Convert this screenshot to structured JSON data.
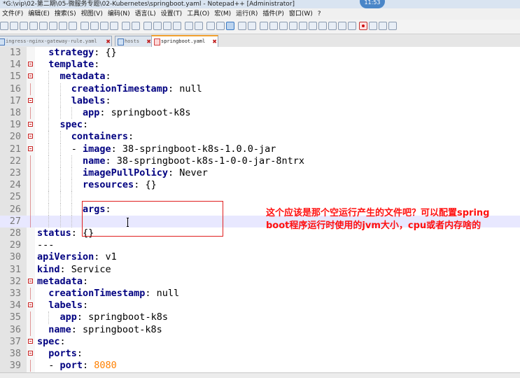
{
  "window": {
    "title": "*G:\\vip\\02-第二期\\05-微服务专题\\02-Kubernetes\\springboot.yaml - Notepad++ [Administrator]",
    "clock": "11:53"
  },
  "menu": [
    "文件(F)",
    "编辑(E)",
    "搜索(S)",
    "视图(V)",
    "编码(N)",
    "语言(L)",
    "设置(T)",
    "工具(O)",
    "宏(M)",
    "运行(R)",
    "插件(P)",
    "窗口(W)",
    "?"
  ],
  "tabs": [
    {
      "label": "ingress-nginx-gateway-rule.yaml",
      "active": false
    },
    {
      "label": "hosts",
      "active": false
    },
    {
      "label": "springboot.yaml",
      "active": true
    }
  ],
  "editor": {
    "current_line": 27,
    "lines": [
      {
        "n": "13",
        "indent": 2,
        "key": "strategy",
        "rest": ": {}"
      },
      {
        "n": "14",
        "indent": 2,
        "key": "template",
        "rest": ":"
      },
      {
        "n": "15",
        "indent": 4,
        "key": "metadata",
        "rest": ":"
      },
      {
        "n": "16",
        "indent": 6,
        "key": "creationTimestamp",
        "rest": ": null"
      },
      {
        "n": "17",
        "indent": 6,
        "key": "labels",
        "rest": ":"
      },
      {
        "n": "18",
        "indent": 8,
        "key": "app",
        "rest": ": springboot-k8s"
      },
      {
        "n": "19",
        "indent": 4,
        "key": "spec",
        "rest": ":"
      },
      {
        "n": "20",
        "indent": 6,
        "key": "containers",
        "rest": ":"
      },
      {
        "n": "21",
        "indent": 6,
        "key": "image",
        "dash": true,
        "rest": ": 38-springboot-k8s-1.0.0-jar"
      },
      {
        "n": "22",
        "indent": 8,
        "key": "name",
        "rest": ": 38-springboot-k8s-1-0-0-jar-8ntrx"
      },
      {
        "n": "23",
        "indent": 8,
        "key": "imagePullPolicy",
        "rest": ": Never"
      },
      {
        "n": "24",
        "indent": 8,
        "key": "resources",
        "rest": ": {}"
      },
      {
        "n": "25",
        "indent": 0,
        "key": "",
        "rest": ""
      },
      {
        "n": "26",
        "indent": 8,
        "key": "args",
        "rest": ":"
      },
      {
        "n": "27",
        "indent": 0,
        "key": "",
        "rest": ""
      },
      {
        "n": "28",
        "indent": 0,
        "key": "status",
        "rest": ": {}"
      },
      {
        "n": "29",
        "indent": 0,
        "key": "",
        "rest": "---"
      },
      {
        "n": "30",
        "indent": 0,
        "key": "apiVersion",
        "rest": ": v1"
      },
      {
        "n": "31",
        "indent": 0,
        "key": "kind",
        "rest": ": Service"
      },
      {
        "n": "32",
        "indent": 0,
        "key": "metadata",
        "rest": ":"
      },
      {
        "n": "33",
        "indent": 2,
        "key": "creationTimestamp",
        "rest": ": null"
      },
      {
        "n": "34",
        "indent": 2,
        "key": "labels",
        "rest": ":"
      },
      {
        "n": "35",
        "indent": 4,
        "key": "app",
        "rest": ": springboot-k8s"
      },
      {
        "n": "36",
        "indent": 2,
        "key": "name",
        "rest": ": springboot-k8s"
      },
      {
        "n": "37",
        "indent": 0,
        "key": "spec",
        "rest": ":"
      },
      {
        "n": "38",
        "indent": 2,
        "key": "ports",
        "rest": ":"
      },
      {
        "n": "39",
        "indent": 2,
        "key": "port",
        "dash": true,
        "rest": ": ",
        "num": "8080"
      }
    ]
  },
  "annotation": {
    "line1": "这个应该是那个空运行产生的文件吧？可以配置spring",
    "line2": "boot程序运行时使用的jvm大小，cpu或者内存啥的",
    "color": "#ff1010"
  }
}
